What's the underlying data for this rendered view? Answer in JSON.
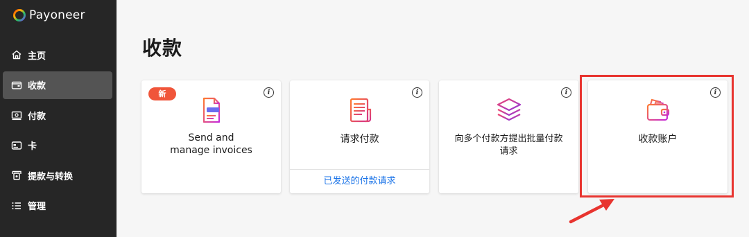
{
  "app": {
    "brand": "Payoneer"
  },
  "sidebar": {
    "items": [
      {
        "label": "主页",
        "icon": "home-icon",
        "active": false
      },
      {
        "label": "收款",
        "icon": "wallet-icon",
        "active": true
      },
      {
        "label": "付款",
        "icon": "money-bill-icon",
        "active": false
      },
      {
        "label": "卡",
        "icon": "card-icon",
        "active": false
      },
      {
        "label": "提款与转换",
        "icon": "withdraw-icon",
        "active": false
      },
      {
        "label": "管理",
        "icon": "list-icon",
        "active": false
      }
    ]
  },
  "main": {
    "title": "收款",
    "cards": [
      {
        "title_line1": "Send and",
        "title_line2": "manage invoices",
        "badge": "新",
        "icon": "invoice-icon"
      },
      {
        "title": "请求付款",
        "footer_link": "已发送的付款请求",
        "icon": "request-payment-icon"
      },
      {
        "title_line1": "向多个付款方提出批量付款",
        "title_line2": "请求",
        "icon": "stack-icon"
      },
      {
        "title": "收款账户",
        "icon": "receiving-wallet-icon",
        "highlighted": true
      }
    ]
  },
  "colors": {
    "sidebar_bg": "#262626",
    "sidebar_active": "#545454",
    "main_bg": "#f6f6f6",
    "badge": "#f0553a",
    "link": "#1a73e8",
    "annotation_red": "#e8342f"
  }
}
